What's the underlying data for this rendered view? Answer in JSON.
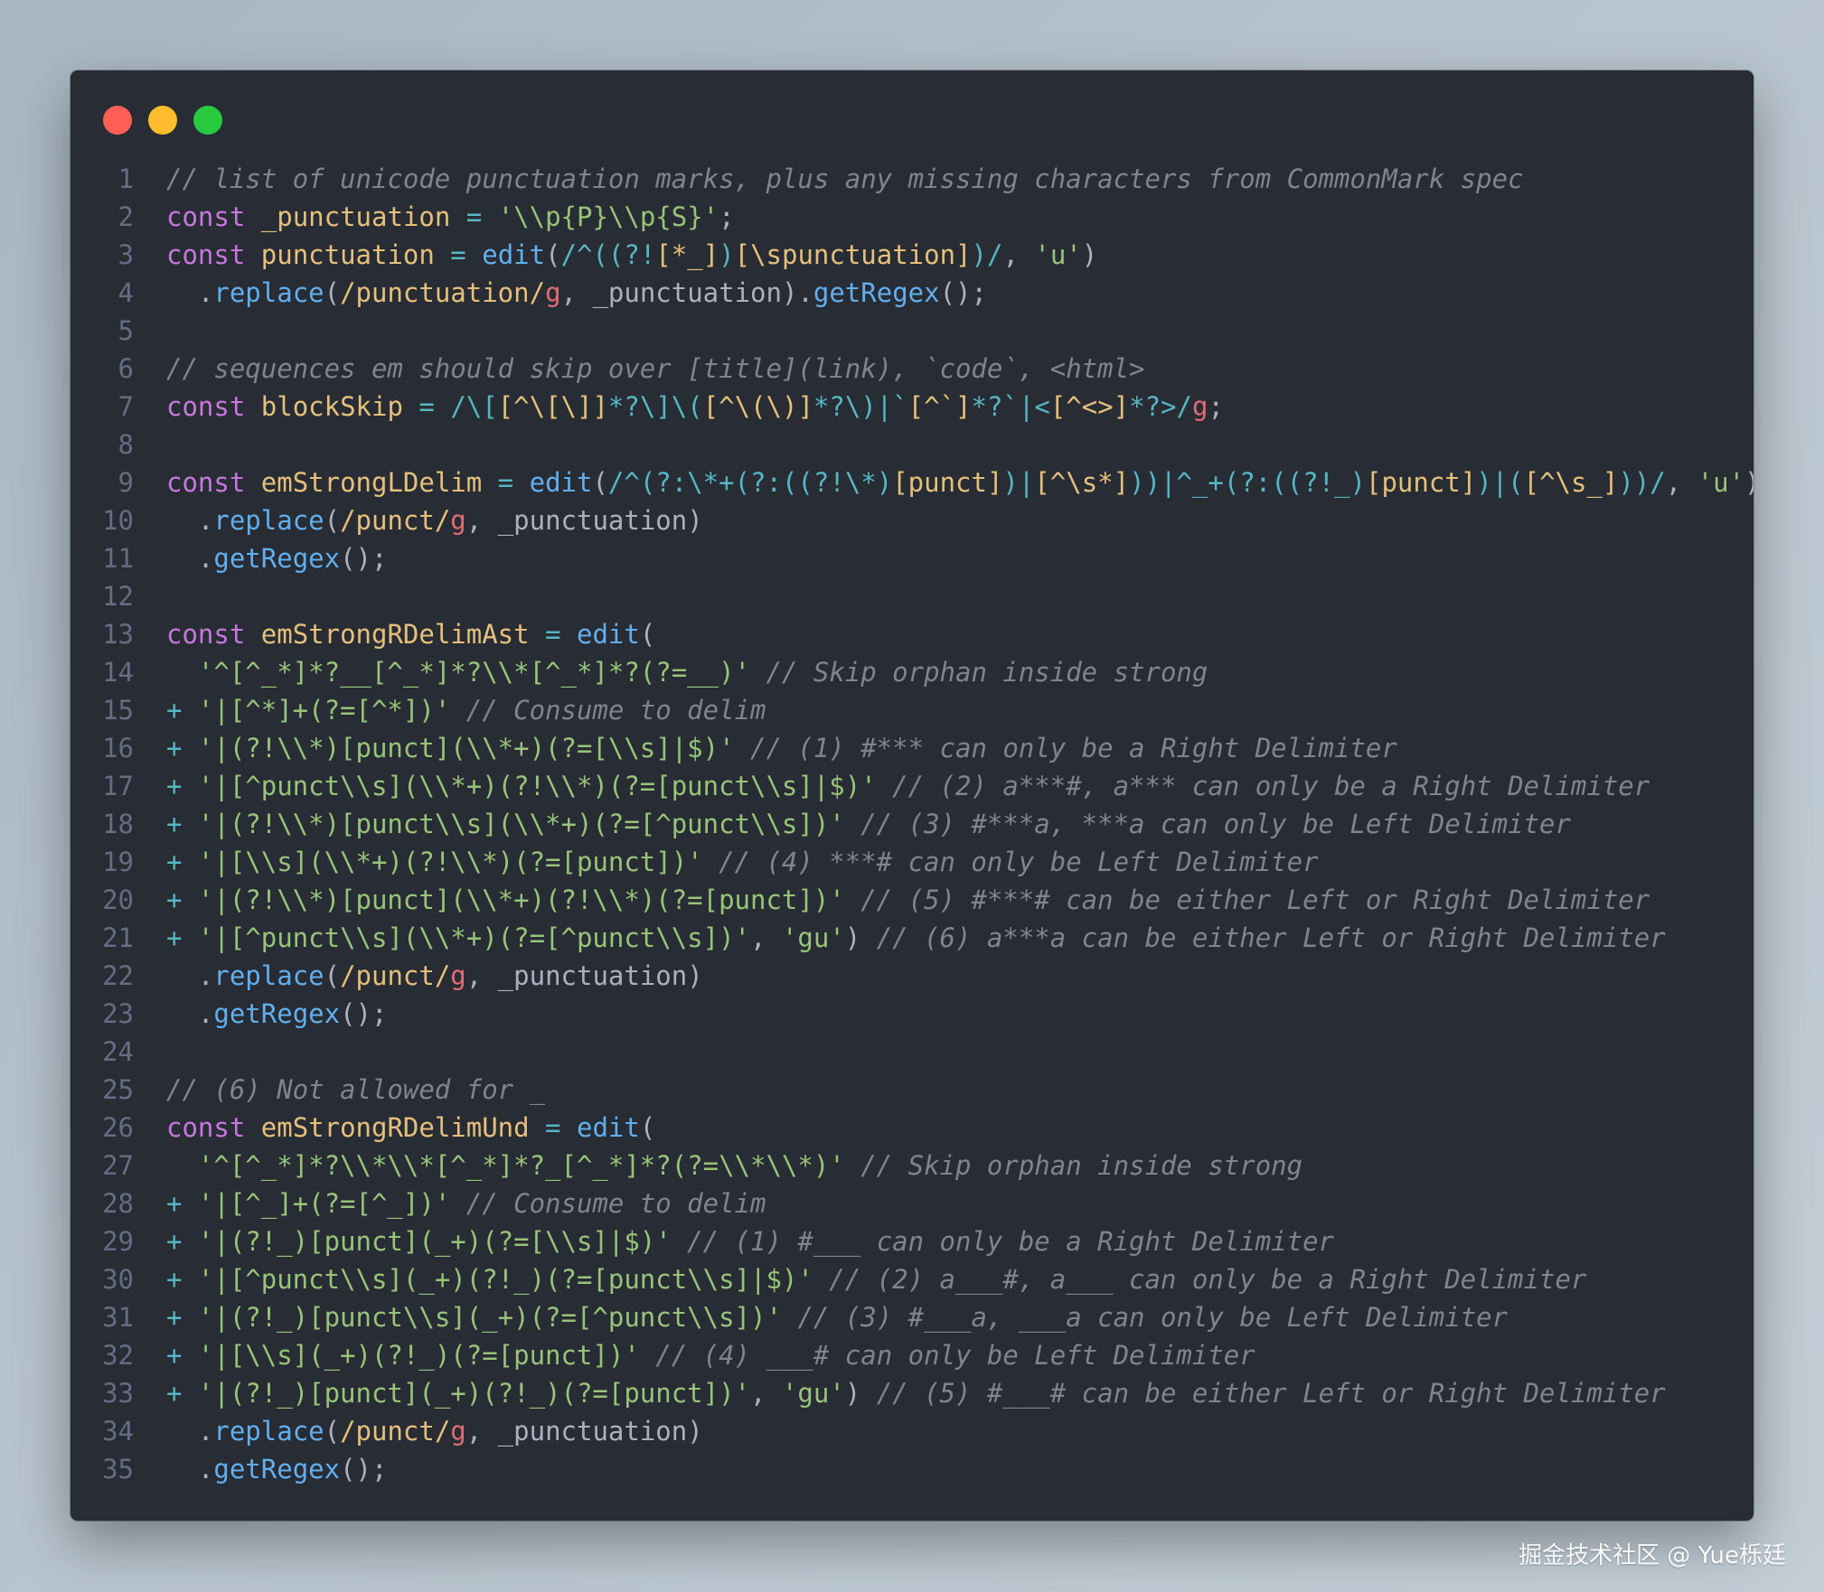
{
  "window": {
    "controls": {
      "close": {
        "color": "#ff5f56"
      },
      "minimize": {
        "color": "#ffbd2e"
      },
      "zoom": {
        "color": "#27c93f"
      }
    }
  },
  "theme": {
    "background": "#282c34",
    "keyword": "#c678dd",
    "variable": "#e5c07b",
    "function": "#61afef",
    "string": "#98c379",
    "comment": "#7f848e",
    "operator": "#56b6c2"
  },
  "code": {
    "lines": [
      {
        "n": "1",
        "tokens": [
          {
            "t": "// list of unicode punctuation marks, plus any missing characters from CommonMark spec",
            "k": "cm"
          }
        ]
      },
      {
        "n": "2",
        "tokens": [
          {
            "t": "const",
            "k": "kw"
          },
          {
            "t": " ",
            "k": "pl"
          },
          {
            "t": "_punctuation",
            "k": "var"
          },
          {
            "t": " = ",
            "k": "op"
          },
          {
            "t": "'\\\\p{P}\\\\p{S}'",
            "k": "str"
          },
          {
            "t": ";",
            "k": "pl"
          }
        ]
      },
      {
        "n": "3",
        "tokens": [
          {
            "t": "const",
            "k": "kw"
          },
          {
            "t": " ",
            "k": "pl"
          },
          {
            "t": "punctuation",
            "k": "var"
          },
          {
            "t": " = ",
            "k": "op"
          },
          {
            "t": "edit",
            "k": "fn"
          },
          {
            "t": "(",
            "k": "pl"
          },
          {
            "t": "/^((?!",
            "k": "rx"
          },
          {
            "t": "[*_]",
            "k": "rxc"
          },
          {
            "t": ")",
            "k": "rx"
          },
          {
            "t": "[\\spunctuation]",
            "k": "rxc"
          },
          {
            "t": ")/",
            "k": "rx"
          },
          {
            "t": ", ",
            "k": "pl"
          },
          {
            "t": "'u'",
            "k": "str"
          },
          {
            "t": ")",
            "k": "pl"
          }
        ]
      },
      {
        "n": "4",
        "tokens": [
          {
            "t": "  .",
            "k": "pl"
          },
          {
            "t": "replace",
            "k": "fn"
          },
          {
            "t": "(",
            "k": "pl"
          },
          {
            "t": "/punctuation/",
            "k": "rxc"
          },
          {
            "t": "g",
            "k": "flag"
          },
          {
            "t": ", _punctuation).",
            "k": "pl"
          },
          {
            "t": "getRegex",
            "k": "fn"
          },
          {
            "t": "();",
            "k": "pl"
          }
        ]
      },
      {
        "n": "5",
        "tokens": []
      },
      {
        "n": "6",
        "tokens": [
          {
            "t": "// sequences em should skip over [title](link), `code`, <html>",
            "k": "cm"
          }
        ]
      },
      {
        "n": "7",
        "tokens": [
          {
            "t": "const",
            "k": "kw"
          },
          {
            "t": " ",
            "k": "pl"
          },
          {
            "t": "blockSkip",
            "k": "var"
          },
          {
            "t": " = ",
            "k": "op"
          },
          {
            "t": "/\\[",
            "k": "rx"
          },
          {
            "t": "[^\\[\\]]",
            "k": "rxc"
          },
          {
            "t": "*?\\]\\(",
            "k": "rx"
          },
          {
            "t": "[^\\(\\)]",
            "k": "rxc"
          },
          {
            "t": "*?\\)|`",
            "k": "rx"
          },
          {
            "t": "[^`]",
            "k": "rxc"
          },
          {
            "t": "*?`|<",
            "k": "rx"
          },
          {
            "t": "[^<>]",
            "k": "rxc"
          },
          {
            "t": "*?>/",
            "k": "rx"
          },
          {
            "t": "g",
            "k": "flag"
          },
          {
            "t": ";",
            "k": "pl"
          }
        ]
      },
      {
        "n": "8",
        "tokens": []
      },
      {
        "n": "9",
        "tokens": [
          {
            "t": "const",
            "k": "kw"
          },
          {
            "t": " ",
            "k": "pl"
          },
          {
            "t": "emStrongLDelim",
            "k": "var"
          },
          {
            "t": " = ",
            "k": "op"
          },
          {
            "t": "edit",
            "k": "fn"
          },
          {
            "t": "(",
            "k": "pl"
          },
          {
            "t": "/^(?:\\*+(?:((?!\\*)",
            "k": "rx"
          },
          {
            "t": "[punct]",
            "k": "rxc"
          },
          {
            "t": ")|",
            "k": "rx"
          },
          {
            "t": "[^\\s*]",
            "k": "rxc"
          },
          {
            "t": "))|^_+(?:((?!_)",
            "k": "rx"
          },
          {
            "t": "[punct]",
            "k": "rxc"
          },
          {
            "t": ")|(",
            "k": "rx"
          },
          {
            "t": "[^\\s_]",
            "k": "rxc"
          },
          {
            "t": "))/",
            "k": "rx"
          },
          {
            "t": ", ",
            "k": "pl"
          },
          {
            "t": "'u'",
            "k": "str"
          },
          {
            "t": ")",
            "k": "pl"
          }
        ]
      },
      {
        "n": "10",
        "tokens": [
          {
            "t": "  .",
            "k": "pl"
          },
          {
            "t": "replace",
            "k": "fn"
          },
          {
            "t": "(",
            "k": "pl"
          },
          {
            "t": "/punct/",
            "k": "rxc"
          },
          {
            "t": "g",
            "k": "flag"
          },
          {
            "t": ", _punctuation)",
            "k": "pl"
          }
        ]
      },
      {
        "n": "11",
        "tokens": [
          {
            "t": "  .",
            "k": "pl"
          },
          {
            "t": "getRegex",
            "k": "fn"
          },
          {
            "t": "();",
            "k": "pl"
          }
        ]
      },
      {
        "n": "12",
        "tokens": []
      },
      {
        "n": "13",
        "tokens": [
          {
            "t": "const",
            "k": "kw"
          },
          {
            "t": " ",
            "k": "pl"
          },
          {
            "t": "emStrongRDelimAst",
            "k": "var"
          },
          {
            "t": " = ",
            "k": "op"
          },
          {
            "t": "edit",
            "k": "fn"
          },
          {
            "t": "(",
            "k": "pl"
          }
        ]
      },
      {
        "n": "14",
        "tokens": [
          {
            "t": "  '^[^_*]*?__[^_*]*?\\\\*[^_*]*?(?=__)'",
            "k": "str"
          },
          {
            "t": " // Skip orphan inside strong",
            "k": "cm"
          }
        ]
      },
      {
        "n": "15",
        "tokens": [
          {
            "t": "+ ",
            "k": "op"
          },
          {
            "t": "'|[^*]+(?=[^*])'",
            "k": "str"
          },
          {
            "t": " // Consume to delim",
            "k": "cm"
          }
        ]
      },
      {
        "n": "16",
        "tokens": [
          {
            "t": "+ ",
            "k": "op"
          },
          {
            "t": "'|(?!\\\\*)[punct](\\\\*+)(?=[\\\\s]|$)'",
            "k": "str"
          },
          {
            "t": " // (1) #*** can only be a Right Delimiter",
            "k": "cm"
          }
        ]
      },
      {
        "n": "17",
        "tokens": [
          {
            "t": "+ ",
            "k": "op"
          },
          {
            "t": "'|[^punct\\\\s](\\\\*+)(?!\\\\*)(?=[punct\\\\s]|$)'",
            "k": "str"
          },
          {
            "t": " // (2) a***#, a*** can only be a Right Delimiter",
            "k": "cm"
          }
        ]
      },
      {
        "n": "18",
        "tokens": [
          {
            "t": "+ ",
            "k": "op"
          },
          {
            "t": "'|(?!\\\\*)[punct\\\\s](\\\\*+)(?=[^punct\\\\s])'",
            "k": "str"
          },
          {
            "t": " // (3) #***a, ***a can only be Left Delimiter",
            "k": "cm"
          }
        ]
      },
      {
        "n": "19",
        "tokens": [
          {
            "t": "+ ",
            "k": "op"
          },
          {
            "t": "'|[\\\\s](\\\\*+)(?!\\\\*)(?=[punct])'",
            "k": "str"
          },
          {
            "t": " // (4) ***# can only be Left Delimiter",
            "k": "cm"
          }
        ]
      },
      {
        "n": "20",
        "tokens": [
          {
            "t": "+ ",
            "k": "op"
          },
          {
            "t": "'|(?!\\\\*)[punct](\\\\*+)(?!\\\\*)(?=[punct])'",
            "k": "str"
          },
          {
            "t": " // (5) #***# can be either Left or Right Delimiter",
            "k": "cm"
          }
        ]
      },
      {
        "n": "21",
        "tokens": [
          {
            "t": "+ ",
            "k": "op"
          },
          {
            "t": "'|[^punct\\\\s](\\\\*+)(?=[^punct\\\\s])'",
            "k": "str"
          },
          {
            "t": ", ",
            "k": "pl"
          },
          {
            "t": "'gu'",
            "k": "str"
          },
          {
            "t": ")",
            "k": "pl"
          },
          {
            "t": " // (6) a***a can be either Left or Right Delimiter",
            "k": "cm"
          }
        ]
      },
      {
        "n": "22",
        "tokens": [
          {
            "t": "  .",
            "k": "pl"
          },
          {
            "t": "replace",
            "k": "fn"
          },
          {
            "t": "(",
            "k": "pl"
          },
          {
            "t": "/punct/",
            "k": "rxc"
          },
          {
            "t": "g",
            "k": "flag"
          },
          {
            "t": ", _punctuation)",
            "k": "pl"
          }
        ]
      },
      {
        "n": "23",
        "tokens": [
          {
            "t": "  .",
            "k": "pl"
          },
          {
            "t": "getRegex",
            "k": "fn"
          },
          {
            "t": "();",
            "k": "pl"
          }
        ]
      },
      {
        "n": "24",
        "tokens": []
      },
      {
        "n": "25",
        "tokens": [
          {
            "t": "// (6) Not allowed for _",
            "k": "cm"
          }
        ]
      },
      {
        "n": "26",
        "tokens": [
          {
            "t": "const",
            "k": "kw"
          },
          {
            "t": " ",
            "k": "pl"
          },
          {
            "t": "emStrongRDelimUnd",
            "k": "var"
          },
          {
            "t": " = ",
            "k": "op"
          },
          {
            "t": "edit",
            "k": "fn"
          },
          {
            "t": "(",
            "k": "pl"
          }
        ]
      },
      {
        "n": "27",
        "tokens": [
          {
            "t": "  '^[^_*]*?\\\\*\\\\*[^_*]*?_[^_*]*?(?=\\\\*\\\\*)'",
            "k": "str"
          },
          {
            "t": " // Skip orphan inside strong",
            "k": "cm"
          }
        ]
      },
      {
        "n": "28",
        "tokens": [
          {
            "t": "+ ",
            "k": "op"
          },
          {
            "t": "'|[^_]+(?=[^_])'",
            "k": "str"
          },
          {
            "t": " // Consume to delim",
            "k": "cm"
          }
        ]
      },
      {
        "n": "29",
        "tokens": [
          {
            "t": "+ ",
            "k": "op"
          },
          {
            "t": "'|(?!_)[punct](_+)(?=[\\\\s]|$)'",
            "k": "str"
          },
          {
            "t": " // (1) #___ can only be a Right Delimiter",
            "k": "cm"
          }
        ]
      },
      {
        "n": "30",
        "tokens": [
          {
            "t": "+ ",
            "k": "op"
          },
          {
            "t": "'|[^punct\\\\s](_+)(?!_)(?=[punct\\\\s]|$)'",
            "k": "str"
          },
          {
            "t": " // (2) a___#, a___ can only be a Right Delimiter",
            "k": "cm"
          }
        ]
      },
      {
        "n": "31",
        "tokens": [
          {
            "t": "+ ",
            "k": "op"
          },
          {
            "t": "'|(?!_)[punct\\\\s](_+)(?=[^punct\\\\s])'",
            "k": "str"
          },
          {
            "t": " // (3) #___a, ___a can only be Left Delimiter",
            "k": "cm"
          }
        ]
      },
      {
        "n": "32",
        "tokens": [
          {
            "t": "+ ",
            "k": "op"
          },
          {
            "t": "'|[\\\\s](_+)(?!_)(?=[punct])'",
            "k": "str"
          },
          {
            "t": " // (4) ___# can only be Left Delimiter",
            "k": "cm"
          }
        ]
      },
      {
        "n": "33",
        "tokens": [
          {
            "t": "+ ",
            "k": "op"
          },
          {
            "t": "'|(?!_)[punct](_+)(?!_)(?=[punct])'",
            "k": "str"
          },
          {
            "t": ", ",
            "k": "pl"
          },
          {
            "t": "'gu'",
            "k": "str"
          },
          {
            "t": ")",
            "k": "pl"
          },
          {
            "t": " // (5) #___# can be either Left or Right Delimiter",
            "k": "cm"
          }
        ]
      },
      {
        "n": "34",
        "tokens": [
          {
            "t": "  .",
            "k": "pl"
          },
          {
            "t": "replace",
            "k": "fn"
          },
          {
            "t": "(",
            "k": "pl"
          },
          {
            "t": "/punct/",
            "k": "rxc"
          },
          {
            "t": "g",
            "k": "flag"
          },
          {
            "t": ", _punctuation)",
            "k": "pl"
          }
        ]
      },
      {
        "n": "35",
        "tokens": [
          {
            "t": "  .",
            "k": "pl"
          },
          {
            "t": "getRegex",
            "k": "fn"
          },
          {
            "t": "();",
            "k": "pl"
          }
        ]
      }
    ]
  },
  "watermark": "掘金技术社区 @ Yue栎廷"
}
